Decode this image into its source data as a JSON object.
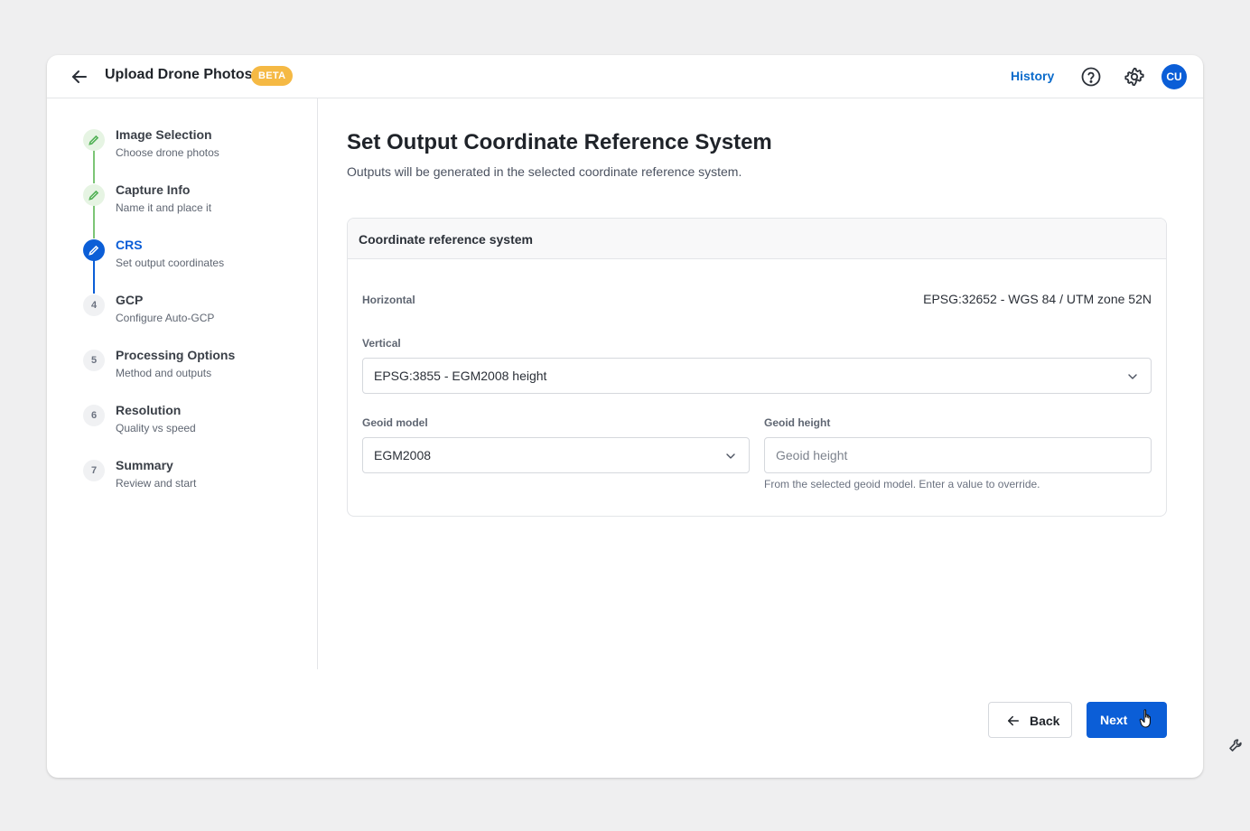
{
  "header": {
    "title": "Upload Drone Photos",
    "badge": "BETA",
    "history_label": "History",
    "avatar_initials": "CU"
  },
  "steps": [
    {
      "number": "",
      "title": "Image Selection",
      "subtitle": "Choose drone photos",
      "status": "complete"
    },
    {
      "number": "",
      "title": "Capture Info",
      "subtitle": "Name it and place it",
      "status": "complete"
    },
    {
      "number": "",
      "title": "CRS",
      "subtitle": "Set output coordinates",
      "status": "active"
    },
    {
      "number": "4",
      "title": "GCP",
      "subtitle": "Configure Auto-GCP",
      "status": "todo"
    },
    {
      "number": "5",
      "title": "Processing Options",
      "subtitle": "Method and outputs",
      "status": "todo"
    },
    {
      "number": "6",
      "title": "Resolution",
      "subtitle": "Quality vs speed",
      "status": "todo"
    },
    {
      "number": "7",
      "title": "Summary",
      "subtitle": "Review and start",
      "status": "todo"
    }
  ],
  "main": {
    "title": "Set Output Coordinate Reference System",
    "subtitle": "Outputs will be generated in the selected coordinate reference system."
  },
  "crs_panel": {
    "title": "Coordinate reference system",
    "horizontal_label": "Horizontal",
    "horizontal_value": "EPSG:32652 - WGS 84 / UTM zone 52N",
    "vertical_label": "Vertical",
    "vertical_value": "EPSG:3855 - EGM2008 height",
    "geoid_model_label": "Geoid model",
    "geoid_model_value": "EGM2008",
    "geoid_height_label": "Geoid height",
    "geoid_height_placeholder": "Geoid height",
    "geoid_height_value": "",
    "geoid_height_helper": "From the selected geoid model. Enter a value to override."
  },
  "footer": {
    "back_label": "Back",
    "next_label": "Next"
  },
  "colors": {
    "accent": "#0b5ed7",
    "link": "#0b6bcb",
    "beta_badge": "#f5b944",
    "complete_green": "#4caf50",
    "connector_done": "#7cc576"
  },
  "icons": {
    "back": "arrow-left-icon",
    "help": "help-circle-icon",
    "settings": "gear-icon",
    "complete_step": "pencil-icon",
    "dropdown": "chevron-down-icon",
    "tool": "wrench-icon"
  }
}
